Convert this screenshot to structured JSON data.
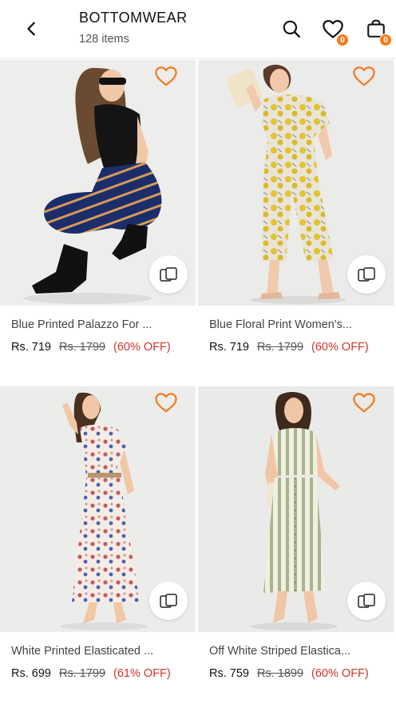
{
  "header": {
    "title": "BOTTOMWEAR",
    "item_count": "128 items",
    "wishlist_badge": "0",
    "bag_badge": "0"
  },
  "colors": {
    "accent": "#f47c20",
    "discount": "#d0342c"
  },
  "products": [
    {
      "name": "Blue Printed Palazzo For ...",
      "price": "Rs. 719",
      "mrp": "Rs. 1799",
      "discount": "(60% OFF)"
    },
    {
      "name": "Blue Floral Print Women's...",
      "price": "Rs. 719",
      "mrp": "Rs. 1799",
      "discount": "(60% OFF)"
    },
    {
      "name": "White Printed Elasticated ...",
      "price": "Rs. 699",
      "mrp": "Rs. 1799",
      "discount": "(61% OFF)"
    },
    {
      "name": "Off White Striped Elastica...",
      "price": "Rs. 759",
      "mrp": "Rs. 1899",
      "discount": "(60% OFF)"
    }
  ]
}
